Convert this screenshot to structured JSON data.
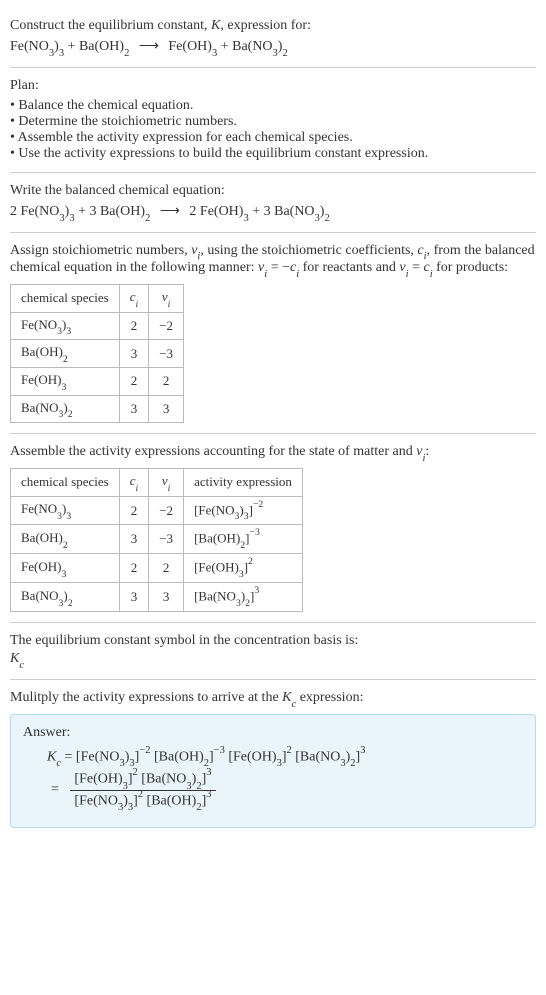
{
  "header": {
    "prompt_l1": "Construct the equilibrium constant, ",
    "prompt_K": "K",
    "prompt_l1b": ", expression for:",
    "reaction_lhs": "Fe(NO",
    "r_3a": "3",
    "r_close3": ")",
    "r_3b": "3",
    "plus": " + ",
    "baoh": "Ba(OH)",
    "r_2": "2",
    "arrow": "⟶",
    "feoh": "Fe(OH)",
    "r_3c": "3",
    "bano": "Ba(NO",
    "r_3d": "3",
    "r_close2": ")",
    "r_2b": "2"
  },
  "plan": {
    "title": "Plan:",
    "items": [
      "Balance the chemical equation.",
      "Determine the stoichiometric numbers.",
      "Assemble the activity expression for each chemical species.",
      "Use the activity expressions to build the equilibrium constant expression."
    ]
  },
  "balanced": {
    "title": "Write the balanced chemical equation:",
    "c1": "2 ",
    "c2": "3 ",
    "c3": "2 ",
    "c4": "3 "
  },
  "stoich": {
    "intro_a": "Assign stoichiometric numbers, ",
    "nu": "ν",
    "sub_i": "i",
    "intro_b": ", using the stoichiometric coefficients, ",
    "c": "c",
    "intro_c": ", from the balanced chemical equation in the following manner: ",
    "eq1_l": "ν",
    "eq1_sub": "i",
    "eq1_mid": " = −",
    "eq1_c": "c",
    "eq1_csub": "i",
    "intro_d": " for reactants and ",
    "eq2_l": "ν",
    "eq2_sub": "i",
    "eq2_mid": " = ",
    "eq2_c": "c",
    "eq2_csub": "i",
    "intro_e": " for products:",
    "headers": [
      "chemical species",
      "cᵢ",
      "νᵢ"
    ],
    "rows": [
      {
        "species": "Fe(NO3)3",
        "c": "2",
        "nu": "−2"
      },
      {
        "species": "Ba(OH)2",
        "c": "3",
        "nu": "−3"
      },
      {
        "species": "Fe(OH)3",
        "c": "2",
        "nu": "2"
      },
      {
        "species": "Ba(NO3)2",
        "c": "3",
        "nu": "3"
      }
    ]
  },
  "activity": {
    "intro_a": "Assemble the activity expressions accounting for the state of matter and ",
    "nu": "ν",
    "sub_i": "i",
    "colon": ":",
    "headers": [
      "chemical species",
      "cᵢ",
      "νᵢ",
      "activity expression"
    ],
    "rows": [
      {
        "species": "Fe(NO3)3",
        "c": "2",
        "nu": "−2",
        "exp_base": "[Fe(NO3)3]",
        "exp_pow": "−2"
      },
      {
        "species": "Ba(OH)2",
        "c": "3",
        "nu": "−3",
        "exp_base": "[Ba(OH)2]",
        "exp_pow": "−3"
      },
      {
        "species": "Fe(OH)3",
        "c": "2",
        "nu": "2",
        "exp_base": "[Fe(OH)3]",
        "exp_pow": "2"
      },
      {
        "species": "Ba(NO3)2",
        "c": "3",
        "nu": "3",
        "exp_base": "[Ba(NO3)2]",
        "exp_pow": "3"
      }
    ]
  },
  "symbol": {
    "line": "The equilibrium constant symbol in the concentration basis is:",
    "K": "K",
    "c": "c"
  },
  "multiply": {
    "line_a": "Mulitply the activity expressions to arrive at the ",
    "K": "K",
    "c": "c",
    "line_b": " expression:"
  },
  "answer": {
    "label": "Answer:",
    "Kc_K": "K",
    "Kc_c": "c",
    "eq": " = ",
    "t1_base": "[Fe(NO3)3]",
    "t1_pow": "−2",
    "t2_base": "[Ba(OH)2]",
    "t2_pow": "−3",
    "t3_base": "[Fe(OH)3]",
    "t3_pow": "2",
    "t4_base": "[Ba(NO3)2]",
    "t4_pow": "3",
    "num1_base": "[Fe(OH)3]",
    "num1_pow": "2",
    "num2_base": "[Ba(NO3)2]",
    "num2_pow": "3",
    "den1_base": "[Fe(NO3)3]",
    "den1_pow": "2",
    "den2_base": "[Ba(OH)2]",
    "den2_pow": "3"
  },
  "species_render": {
    "Fe(NO3)3": {
      "parts": [
        "Fe(NO",
        "3",
        ")",
        "3"
      ]
    },
    "Ba(OH)2": {
      "parts": [
        "Ba(OH)",
        "2"
      ]
    },
    "Fe(OH)3": {
      "parts": [
        "Fe(OH)",
        "3"
      ]
    },
    "Ba(NO3)2": {
      "parts": [
        "Ba(NO",
        "3",
        ")",
        "2"
      ]
    }
  }
}
